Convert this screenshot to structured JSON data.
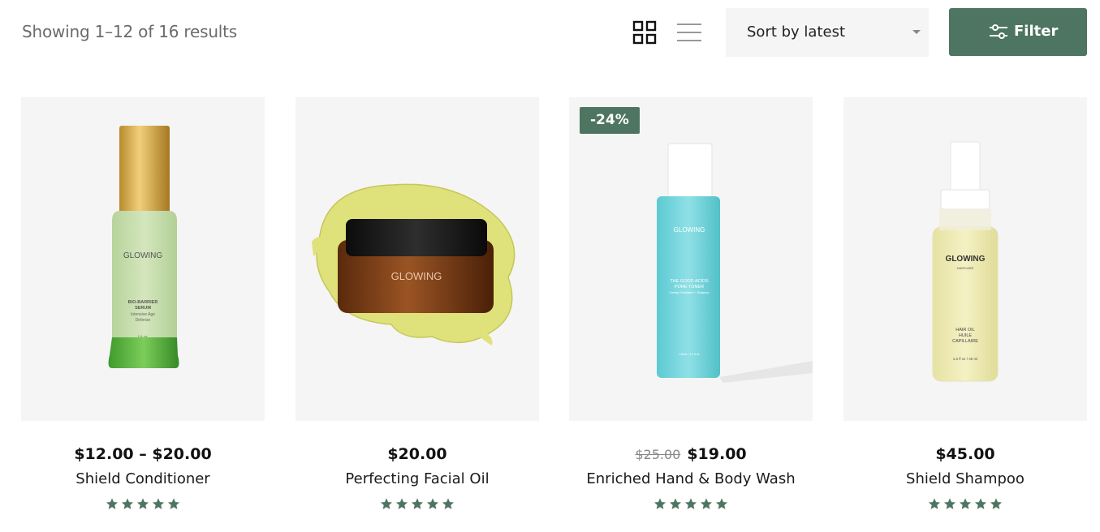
{
  "toolbar": {
    "result_count": "Showing 1–12 of 16 results",
    "grid_view_icon": "grid-icon",
    "list_view_icon": "list-icon",
    "sort": {
      "selected": "Sort by latest",
      "caret_icon": "caret-down-icon"
    },
    "filter_label": "Filter",
    "filter_icon": "sliders-icon"
  },
  "colors": {
    "accent": "#4e7561",
    "card_background": "#f5f5f5",
    "star": "#4e7561"
  },
  "products": [
    {
      "price": "$12.00 – $20.00",
      "title": "Shield Conditioner",
      "rating": 5,
      "image_text": {
        "brand": "GLOWING",
        "line1": "BIO-BARRIER",
        "line2": "SERUM",
        "line3": "Intensive Age",
        "line4": "Defense",
        "size": "1 fl. oz."
      }
    },
    {
      "price": "$20.00",
      "title": "Perfecting Facial Oil",
      "rating": 5,
      "image_text": {
        "brand": "GLOWING"
      }
    },
    {
      "badge": "-24%",
      "old_price": "$25.00",
      "price": "$19.00",
      "title": "Enriched Hand & Body Wash",
      "rating": 5,
      "image_text": {
        "brand": "GLOWING",
        "line1": "THE GOOD ACIDS",
        "line2": "PORE TONER",
        "line3": "Gently Exfoliates + Balance",
        "size": "100ml / 3.4 fl.oz"
      }
    },
    {
      "price": "$45.00",
      "title": "Shield Shampoo",
      "rating": 5,
      "image_text": {
        "brand": "GLOWING",
        "sub": "HAIRCARE",
        "line1": "HAIR OIL",
        "line2": "HUILE",
        "line3": "CAPILLAIRE",
        "size": "1.5 fl oz / 45 ml"
      }
    }
  ]
}
